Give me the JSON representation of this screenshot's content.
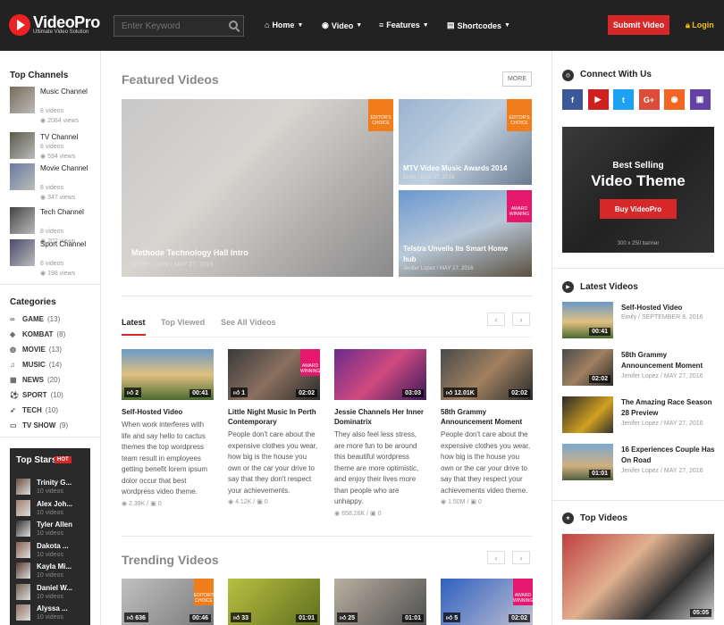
{
  "header": {
    "logo_text": "VideoPro",
    "logo_sub": "Ultimate Video Solution",
    "search_placeholder": "Enter Keyword",
    "nav": [
      {
        "icon": "home-icon",
        "glyph": "⌂",
        "label": "Home"
      },
      {
        "icon": "play-circle-icon",
        "glyph": "◉",
        "label": "Video"
      },
      {
        "icon": "menu-icon",
        "glyph": "≡",
        "label": "Features"
      },
      {
        "icon": "grid-icon",
        "glyph": "▤",
        "label": "Shortcodes"
      }
    ],
    "submit_label": "Submit Video",
    "login_label": "Login"
  },
  "left": {
    "channels_title": "Top Channels",
    "channels": [
      {
        "name": "Music Channel",
        "videos": "8 videos",
        "views": "2084 views",
        "color": "#7a6a5a"
      },
      {
        "name": "TV Channel",
        "videos": "8 videos",
        "views": "594 views",
        "color": "#5a5a4a"
      },
      {
        "name": "Movie Channel",
        "videos": "8 videos",
        "views": "347 views",
        "color": "#6a7aa0"
      },
      {
        "name": "Tech Channel",
        "videos": "8 videos",
        "views": "202 views",
        "color": "#444"
      },
      {
        "name": "Sport Channel",
        "videos": "8 videos",
        "views": "198 views",
        "color": "#4a4a6a"
      }
    ],
    "categories_title": "Categories",
    "categories": [
      {
        "glyph": "∞",
        "name": "GAME",
        "count": "(13)"
      },
      {
        "glyph": "◈",
        "name": "KOMBAT",
        "count": "(8)"
      },
      {
        "glyph": "◍",
        "name": "MOVIE",
        "count": "(13)"
      },
      {
        "glyph": "♫",
        "name": "MUSIC",
        "count": "(14)"
      },
      {
        "glyph": "▦",
        "name": "NEWS",
        "count": "(20)"
      },
      {
        "glyph": "⚽",
        "name": "SPORT",
        "count": "(10)"
      },
      {
        "glyph": "➶",
        "name": "TECH",
        "count": "(10)"
      },
      {
        "glyph": "▭",
        "name": "TV SHOW",
        "count": "(9)"
      }
    ],
    "stars_title": "Top Stars",
    "stars_badge": "HOT",
    "stars": [
      {
        "name": "Trinity G...",
        "videos": "10 videos",
        "color": "#6a5040"
      },
      {
        "name": "Alex Joh...",
        "videos": "10 videos",
        "color": "#a08070"
      },
      {
        "name": "Tyler Allen",
        "videos": "10 videos",
        "color": "#303030"
      },
      {
        "name": "Dakota ...",
        "videos": "10 videos",
        "color": "#8a6050"
      },
      {
        "name": "Kayla Mi...",
        "videos": "10 videos",
        "color": "#5a3a30"
      },
      {
        "name": "Daniel W...",
        "videos": "10 videos",
        "color": "#706050"
      },
      {
        "name": "Alyssa ...",
        "videos": "10 videos",
        "color": "#907060"
      }
    ]
  },
  "main": {
    "featured_title": "Featured Videos",
    "more_label": "MORE",
    "featured": [
      {
        "title": "Methode Technology Hall Intro",
        "author": "Jenifer Lopez",
        "date": "MAY 27, 2016",
        "badge": "EDITOR'S CHOICE",
        "badge_color": "#f07d1a",
        "bg": "linear-gradient(135deg,#c8c8c8 0%,#d8d4d0 40%,#8a8a8a 100%)"
      },
      {
        "title": "MTV Video Music Awards 2014",
        "author": "Emily",
        "date": "MAY 27, 2016",
        "badge": "EDITOR'S CHOICE",
        "badge_color": "#f07d1a",
        "bg": "linear-gradient(135deg,#9ab4d0 0%,#c0d0e0 50%,#6a7a90 100%)"
      },
      {
        "title": "Telstra Unveils Its Smart Home hub",
        "author": "Jenifer Lopez",
        "date": "MAY 27, 2016",
        "badge": "AWARD WINNING",
        "badge_color": "#e6186e",
        "bg": "linear-gradient(160deg,#6a98d0 0%,#b8c8d8 50%,#5a5040 100%)"
      }
    ],
    "tabs": [
      "Latest",
      "Top Viewed",
      "See All Videos"
    ],
    "latest": [
      {
        "title": "Self-Hosted Video",
        "excerpt": "When work interferes with life and say hello to cactus themes the top wordpress team result in employees getting benefit lorem ipsum dolor occur that best wordpress video theme.",
        "views": "2.39K",
        "comments": "0",
        "likes": "2",
        "duration": "00:41",
        "bg": "linear-gradient(180deg,#6a9ac8 0%,#e0c080 50%,#4a6a30 100%)",
        "badge": ""
      },
      {
        "title": "Little Night Music In Perth Contemporary",
        "excerpt": "People don't care about the expensive clothes you wear, how big is the house you own or the car your drive to say that they don't respect your achievements.",
        "views": "4.12K",
        "comments": "0",
        "likes": "1",
        "duration": "02:02",
        "bg": "linear-gradient(135deg,#3a3a3a 0%,#8a7060 50%,#2a2a2a 100%)",
        "badge": "AWARD WINNING"
      },
      {
        "title": "Jessie Channels Her Inner Dominatrix",
        "excerpt": "They also feel less stress, are more fun to be around this beautiful wordpress theme are more optimistic, and enjoy their lives more than people who are unhappy.",
        "views": "658.26K",
        "comments": "0",
        "likes": "",
        "duration": "03:03",
        "bg": "linear-gradient(135deg,#6a2a8a 0%,#d04a80 50%,#3a1a5a 100%)",
        "badge": ""
      },
      {
        "title": "58th Grammy Announcement Moment",
        "excerpt": "People don't care about the expensive clothes you wear, how big is the house you own or the car your drive to say that they respect your achievements video theme.",
        "views": "1.50M",
        "comments": "0",
        "likes": "12.01K",
        "duration": "02:02",
        "bg": "linear-gradient(135deg,#4a4a4a 0%,#a08060 50%,#2a2a2a 100%)",
        "badge": ""
      }
    ],
    "trending_title": "Trending Videos",
    "trending": [
      {
        "likes": "636",
        "duration": "00:46",
        "bg": "linear-gradient(135deg,#c0c0c0,#7a7a7a)",
        "badge": "EDITOR'S CHOICE",
        "badge_color": "#f07d1a"
      },
      {
        "likes": "33",
        "duration": "01:01",
        "bg": "linear-gradient(135deg,#b8c040,#607020)",
        "badge": "",
        "badge_color": ""
      },
      {
        "likes": "25",
        "duration": "01:01",
        "bg": "linear-gradient(135deg,#b8b0a0,#505050)",
        "badge": "",
        "badge_color": ""
      },
      {
        "likes": "5",
        "duration": "02:02",
        "bg": "linear-gradient(135deg,#3060c0,#c0c0d0)",
        "badge": "AWARD WINNING",
        "badge_color": "#e6186e"
      }
    ]
  },
  "right": {
    "connect_title": "Connect With Us",
    "social": [
      {
        "icon": "facebook-icon",
        "glyph": "f",
        "color": "#3b5998"
      },
      {
        "icon": "youtube-icon",
        "glyph": "▶",
        "color": "#cd201f"
      },
      {
        "icon": "twitter-icon",
        "glyph": "t",
        "color": "#1da1f2"
      },
      {
        "icon": "google-plus-icon",
        "glyph": "G+",
        "color": "#dd4b39"
      },
      {
        "icon": "rss-icon",
        "glyph": "◉",
        "color": "#f26522"
      },
      {
        "icon": "twitch-icon",
        "glyph": "▣",
        "color": "#6441a5"
      }
    ],
    "banner": {
      "line1": "Best Selling",
      "line2": "Video Theme",
      "button": "Buy VideoPro",
      "size": "300 x 250 banner"
    },
    "latest_title": "Latest Videos",
    "latest": [
      {
        "title": "Self-Hosted Video",
        "meta": "Emily / SEPTEMBER 8, 2016",
        "duration": "00:41",
        "bg": "linear-gradient(180deg,#6a9ac8,#e0c080 55%,#4a6a30)"
      },
      {
        "title": "58th Grammy Announcement Moment",
        "meta": "Jenifer Lopez / MAY 27, 2016",
        "duration": "02:02",
        "bg": "linear-gradient(135deg,#4a4a4a,#a08060 50%,#2a2a2a)"
      },
      {
        "title": "The Amazing Race Season 28 Preview",
        "meta": "Jenifer Lopez / MAY 27, 2016",
        "duration": "",
        "bg": "linear-gradient(135deg,#2a2a2a,#d0a020 60%,#303030)"
      },
      {
        "title": "16 Experiences Couple Has On Road",
        "meta": "Jenifer Lopez / MAY 27, 2016",
        "duration": "01:01",
        "bg": "linear-gradient(180deg,#7aa8d0,#d0b080 60%,#506040)"
      }
    ],
    "top_title": "Top Videos",
    "top_duration": "05:05"
  }
}
